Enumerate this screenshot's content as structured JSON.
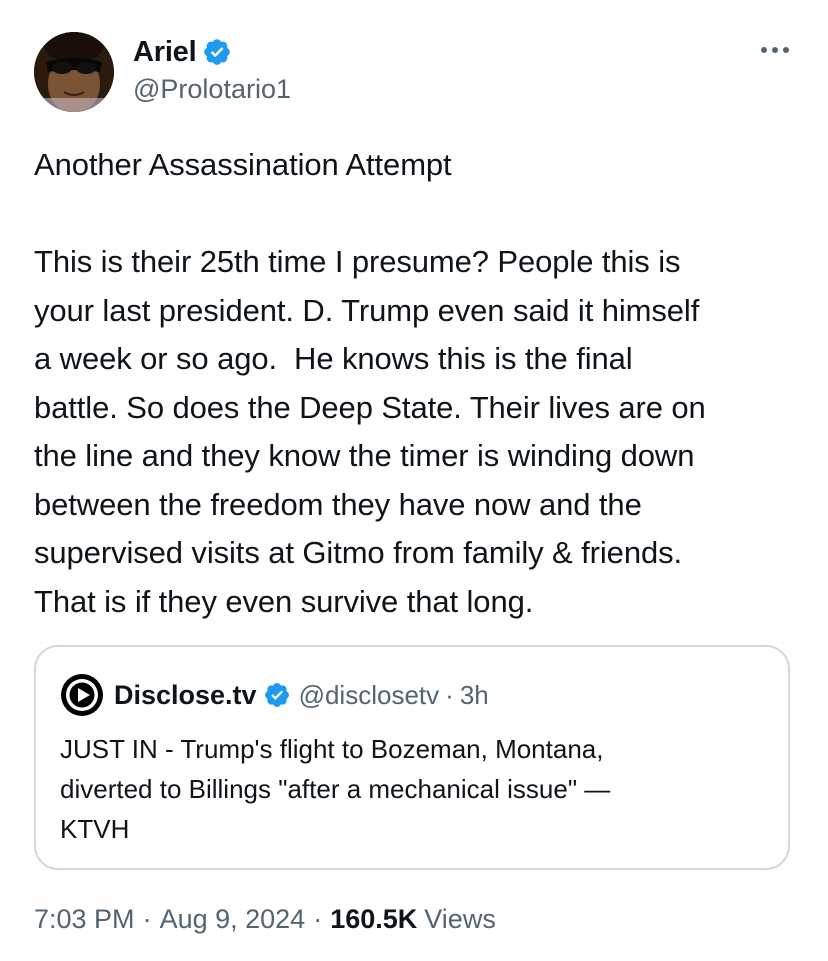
{
  "author": {
    "display_name": "Ariel",
    "handle": "@Prolotario1",
    "verified": true
  },
  "tweet": {
    "text": "Another Assassination Attempt\n\nThis is their 25th time I presume? People this is\nyour last president. D. Trump even said it himself\na week or so ago.  He knows this is the final\nbattle. So does the Deep State. Their lives are on\nthe line and they know the timer is winding down\nbetween the freedom they have now and the\nsupervised visits at Gitmo from family & friends.\nThat is if they even survive that long."
  },
  "quote": {
    "display_name": "Disclose.tv",
    "handle": "@disclosetv",
    "separator": "·",
    "time": "3h",
    "text": "JUST IN - Trump's flight to Bozeman, Montana,\ndiverted to Billings \"after a mechanical issue\" —\nKTVH"
  },
  "meta": {
    "time": "7:03 PM",
    "separator": "·",
    "date": "Aug 9, 2024",
    "views_count": "160.5K",
    "views_label": "Views"
  },
  "icons": {
    "verified": "verified-badge-icon",
    "more": "more-horizontal-icon",
    "quote_avatar": "disclose-logo-icon"
  },
  "colors": {
    "verified_blue": "#1d9bf0",
    "text_primary": "#0f1419",
    "text_secondary": "#536471",
    "border": "#cfd9de"
  }
}
